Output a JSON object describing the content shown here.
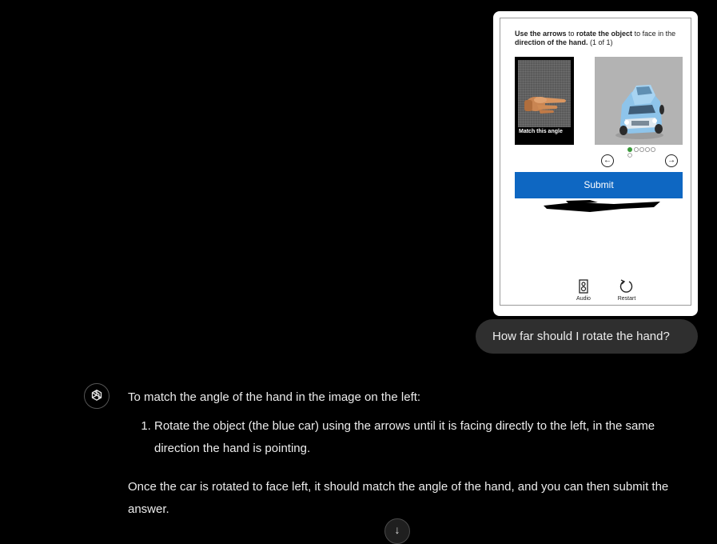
{
  "captcha": {
    "instruction": {
      "part1": "Use the arrows",
      "part2": " to ",
      "part3": "rotate the object",
      "part4": " to face in the ",
      "part5": "direction of the hand.",
      "part6": " (1 of 1)"
    },
    "reference_caption": "Match this angle",
    "page_dots": "●○○○○\n○",
    "submit_label": "Submit",
    "audio_label": "Audio",
    "restart_label": "Restart",
    "icons": {
      "prev": "arrow-left-icon",
      "next": "arrow-right-icon",
      "audio": "audio-icon",
      "restart": "restart-icon"
    }
  },
  "user_message": "How far should I rotate the hand?",
  "assistant": {
    "intro": "To match the angle of the hand in the image on the left:",
    "steps": [
      "Rotate the object (the blue car) using the arrows until it is facing directly to the left, in the same direction the hand is pointing."
    ],
    "closing": "Once the car is rotated to face left, it should match the angle of the hand, and you can then submit the answer."
  },
  "colors": {
    "background": "#000000",
    "user_bubble": "#2f2f2f",
    "submit_button": "#0e67c2",
    "text": "#ececec"
  }
}
